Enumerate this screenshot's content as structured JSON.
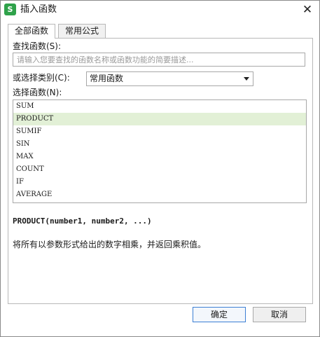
{
  "window": {
    "title": "插入函数",
    "app_icon_glyph": "S",
    "close_glyph": "✕"
  },
  "tabs": [
    {
      "label": "全部函数",
      "active": true
    },
    {
      "label": "常用公式",
      "active": false
    }
  ],
  "search": {
    "label": "查找函数(S):",
    "placeholder": "请输入您要查找的函数名称或函数功能的简要描述..."
  },
  "category": {
    "label": "或选择类别(C):",
    "selected": "常用函数"
  },
  "function_list": {
    "label": "选择函数(N):",
    "items": [
      "SUM",
      "PRODUCT",
      "SUMIF",
      "SIN",
      "MAX",
      "COUNT",
      "IF",
      "AVERAGE"
    ],
    "selected_index": 1
  },
  "syntax": "PRODUCT(number1, number2, ...)",
  "description": "将所有以参数形式给出的数字相乘，并返回乘积值。",
  "buttons": {
    "ok": "确定",
    "cancel": "取消"
  },
  "colors": {
    "app_icon": "#2fa24a",
    "selected_row": "#e2f0d6",
    "ok_border": "#3c7fd4"
  }
}
